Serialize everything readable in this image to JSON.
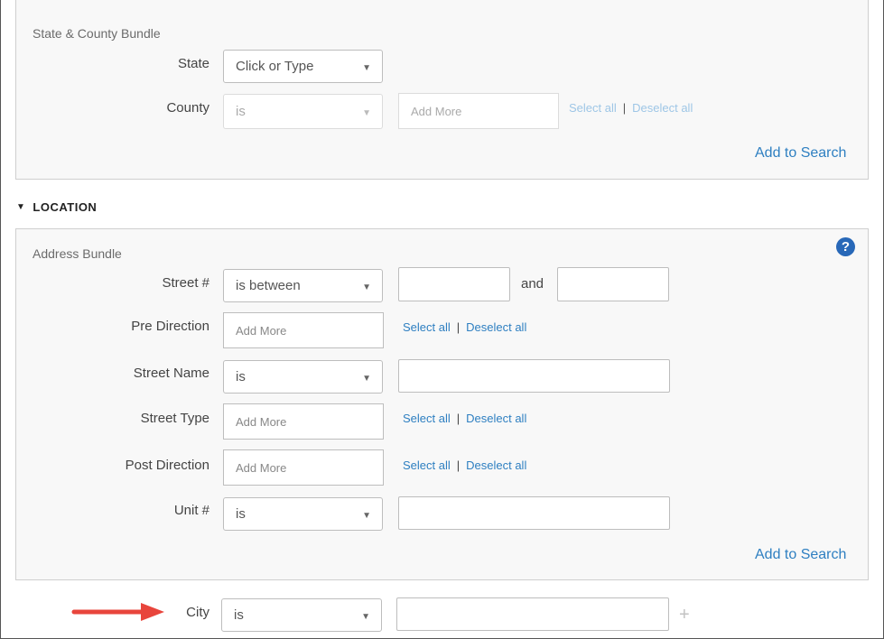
{
  "state_county_bundle": {
    "title": "State & County Bundle",
    "state_label": "State",
    "state_value": "Click or Type",
    "county_label": "County",
    "county_operator": "is",
    "county_add_more": "Add More",
    "select_all": "Select all",
    "separator": "|",
    "deselect_all": "Deselect all",
    "add_to_search": "Add to Search"
  },
  "location_section": {
    "heading": "LOCATION"
  },
  "address_bundle": {
    "title": "Address Bundle",
    "help_icon": "?",
    "street_num_label": "Street #",
    "street_num_operator": "is between",
    "and_label": "and",
    "pre_direction_label": "Pre Direction",
    "pre_direction_add_more": "Add More",
    "street_name_label": "Street Name",
    "street_name_operator": "is",
    "street_type_label": "Street Type",
    "street_type_add_more": "Add More",
    "post_direction_label": "Post Direction",
    "post_direction_add_more": "Add More",
    "unit_label": "Unit #",
    "unit_operator": "is",
    "select_all": "Select all",
    "separator": "|",
    "deselect_all": "Deselect all",
    "add_to_search": "Add to Search"
  },
  "city_row": {
    "label": "City",
    "operator": "is",
    "plus_icon": "+"
  },
  "colors": {
    "link": "#2e7fc1",
    "link_disabled": "#9ec6e6",
    "annotation_arrow": "#e8453c",
    "help_icon": "#2868b8"
  },
  "icons": [
    "chevron-down-icon",
    "caret-down-icon",
    "question-circle-icon",
    "plus-icon",
    "red-arrow-annotation"
  ]
}
